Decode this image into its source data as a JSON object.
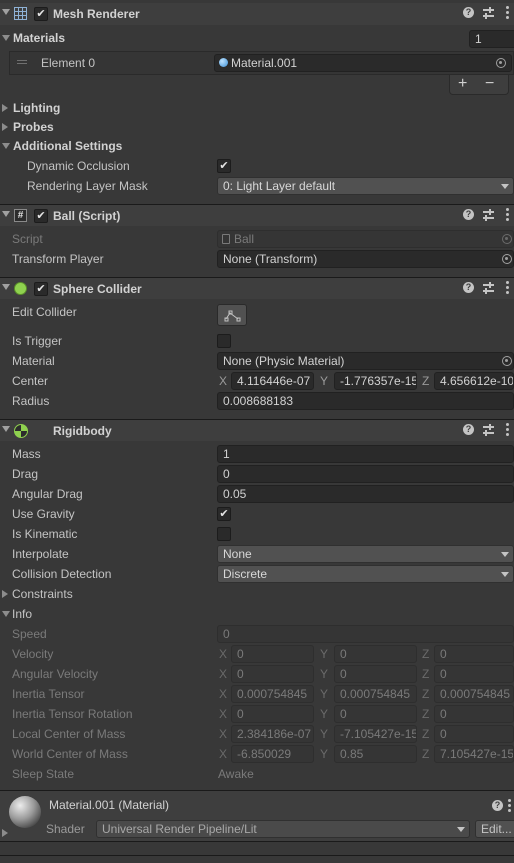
{
  "mesh_renderer": {
    "title": "Mesh Renderer",
    "materials_label": "Materials",
    "materials_count": "1",
    "element_label": "Element 0",
    "element_value": "Material.001",
    "add_label": "+",
    "remove_label": "−",
    "lighting_label": "Lighting",
    "probes_label": "Probes",
    "additional_label": "Additional Settings",
    "dynamic_occlusion_label": "Dynamic Occlusion",
    "rendering_layer_label": "Rendering Layer Mask",
    "rendering_layer_value": "0: Light Layer default"
  },
  "ball_script": {
    "title": "Ball (Script)",
    "script_label": "Script",
    "script_value": "Ball",
    "transform_player_label": "Transform Player",
    "transform_player_value": "None (Transform)"
  },
  "sphere_collider": {
    "title": "Sphere Collider",
    "edit_collider_label": "Edit Collider",
    "is_trigger_label": "Is Trigger",
    "material_label": "Material",
    "material_value": "None (Physic Material)",
    "center_label": "Center",
    "center": {
      "x": "4.116446e-07",
      "y": "-1.776357e-15",
      "z": "4.656612e-10"
    },
    "radius_label": "Radius",
    "radius_value": "0.008688183"
  },
  "rigidbody": {
    "title": "Rigidbody",
    "mass_label": "Mass",
    "mass_value": "1",
    "drag_label": "Drag",
    "drag_value": "0",
    "angular_drag_label": "Angular Drag",
    "angular_drag_value": "0.05",
    "use_gravity_label": "Use Gravity",
    "is_kinematic_label": "Is Kinematic",
    "interpolate_label": "Interpolate",
    "interpolate_value": "None",
    "collision_label": "Collision Detection",
    "collision_value": "Discrete",
    "constraints_label": "Constraints",
    "info_label": "Info",
    "speed_label": "Speed",
    "speed_value": "0",
    "velocity_label": "Velocity",
    "velocity": {
      "x": "0",
      "y": "0",
      "z": "0"
    },
    "angular_velocity_label": "Angular Velocity",
    "angular_velocity": {
      "x": "0",
      "y": "0",
      "z": "0"
    },
    "inertia_tensor_label": "Inertia Tensor",
    "inertia_tensor": {
      "x": "0.000754845",
      "y": "0.000754845",
      "z": "0.000754845"
    },
    "inertia_rotation_label": "Inertia Tensor Rotation",
    "inertia_rotation": {
      "x": "0",
      "y": "0",
      "z": "0"
    },
    "local_com_label": "Local Center of Mass",
    "local_com": {
      "x": "2.384186e-07",
      "y": "-7.105427e-15",
      "z": "0"
    },
    "world_com_label": "World Center of Mass",
    "world_com": {
      "x": "-6.850029",
      "y": "0.85",
      "z": "7.105427e-15"
    },
    "sleep_label": "Sleep State",
    "sleep_value": "Awake"
  },
  "material_panel": {
    "title": "Material.001 (Material)",
    "shader_label": "Shader",
    "shader_value": "Universal Render Pipeline/Lit",
    "edit_label": "Edit..."
  },
  "axis": {
    "x": "X",
    "y": "Y",
    "z": "Z"
  },
  "colors": {
    "background": "#383838",
    "header": "#3e3e3e",
    "field": "#2a2a2a",
    "collider_green": "#8fd14f"
  }
}
